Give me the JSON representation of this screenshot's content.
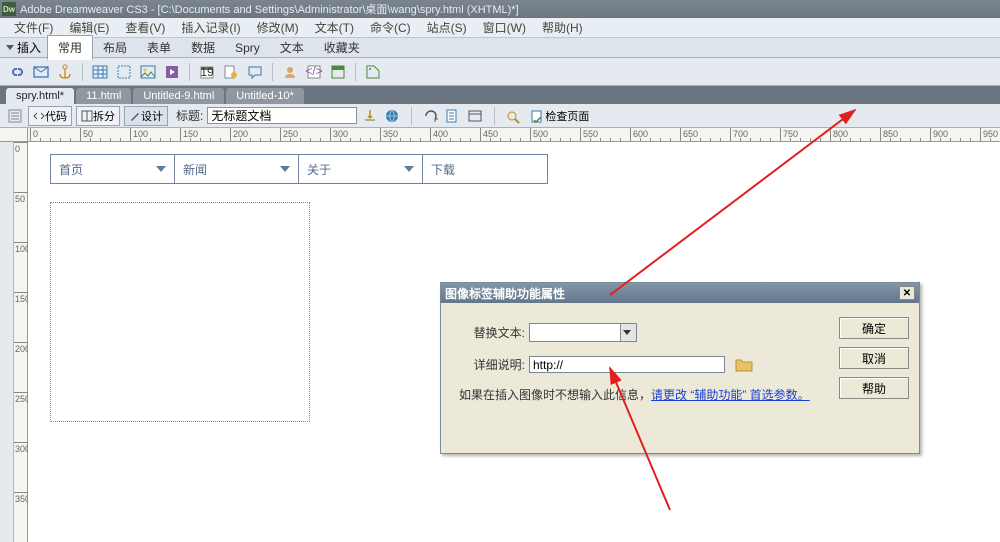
{
  "app": {
    "title": "Adobe Dreamweaver CS3 - [C:\\Documents and Settings\\Administrator\\桌面\\wang\\spry.html (XHTML)*]"
  },
  "menubar": [
    "文件(F)",
    "编辑(E)",
    "查看(V)",
    "插入记录(I)",
    "修改(M)",
    "文本(T)",
    "命令(C)",
    "站点(S)",
    "窗口(W)",
    "帮助(H)"
  ],
  "insert": {
    "label": "插入",
    "tabs": [
      "常用",
      "布局",
      "表单",
      "数据",
      "Spry",
      "文本",
      "收藏夹"
    ],
    "active_tab": "常用"
  },
  "doc_tabs": [
    {
      "label": "spry.html*",
      "active": true
    },
    {
      "label": "11.html",
      "active": false
    },
    {
      "label": "Untitled-9.html",
      "active": false
    },
    {
      "label": "Untitled-10*",
      "active": false
    }
  ],
  "doc_toolbar": {
    "code": "代码",
    "split": "拆分",
    "design": "设计",
    "title_label": "标题:",
    "title_value": "无标题文档",
    "check_page": "检查页面"
  },
  "spry_menu": [
    "首页",
    "新闻",
    "关于",
    "下载"
  ],
  "dialog": {
    "title": "图像标签辅助功能属性",
    "alt_label": "替换文本:",
    "desc_label": "详细说明:",
    "url_value": "http://",
    "msg_prefix": "如果在插入图像时不想输入此信息，",
    "msg_link": "请更改 “辅助功能” 首选参数。",
    "ok": "确定",
    "cancel": "取消",
    "help": "帮助"
  },
  "ruler_major": [
    0,
    50,
    100,
    150,
    200,
    250,
    300,
    350,
    400,
    450,
    500,
    550,
    600,
    650,
    700,
    750,
    800,
    850,
    900,
    950
  ]
}
